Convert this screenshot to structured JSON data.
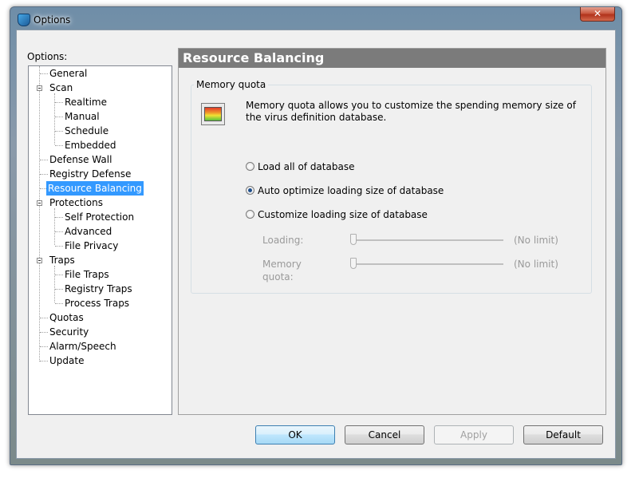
{
  "window": {
    "title": "Options",
    "close_glyph": "✕"
  },
  "tree": {
    "label": "Options:",
    "items": [
      {
        "label": "General"
      },
      {
        "label": "Scan"
      },
      {
        "label": "Realtime"
      },
      {
        "label": "Manual"
      },
      {
        "label": "Schedule"
      },
      {
        "label": "Embedded"
      },
      {
        "label": "Defense Wall"
      },
      {
        "label": "Registry Defense"
      },
      {
        "label": "Resource Balancing",
        "selected": true
      },
      {
        "label": "Protections"
      },
      {
        "label": "Self Protection"
      },
      {
        "label": "Advanced"
      },
      {
        "label": "File Privacy"
      },
      {
        "label": "Traps"
      },
      {
        "label": "File Traps"
      },
      {
        "label": "Registry Traps"
      },
      {
        "label": "Process Traps"
      },
      {
        "label": "Quotas"
      },
      {
        "label": "Security"
      },
      {
        "label": "Alarm/Speech"
      },
      {
        "label": "Update"
      }
    ]
  },
  "panel": {
    "header": "Resource Balancing",
    "group_title": "Memory quota",
    "description": "Memory quota allows you to customize the spending memory size of the virus definition database.",
    "radios": [
      {
        "label": "Load all of database",
        "checked": false
      },
      {
        "label": "Auto optimize loading size of database",
        "checked": true
      },
      {
        "label": "Customize loading size of database",
        "checked": false
      }
    ],
    "sliders": [
      {
        "label": "Loading:",
        "value_text": "(No limit)",
        "level": 0
      },
      {
        "label": "Memory quota:",
        "value_text": "(No limit)",
        "level": 0
      }
    ]
  },
  "buttons": {
    "ok": "OK",
    "cancel": "Cancel",
    "apply": "Apply",
    "default": "Default"
  },
  "colors": {
    "selection": "#3399ff",
    "header_bg": "#7b7b7b"
  }
}
